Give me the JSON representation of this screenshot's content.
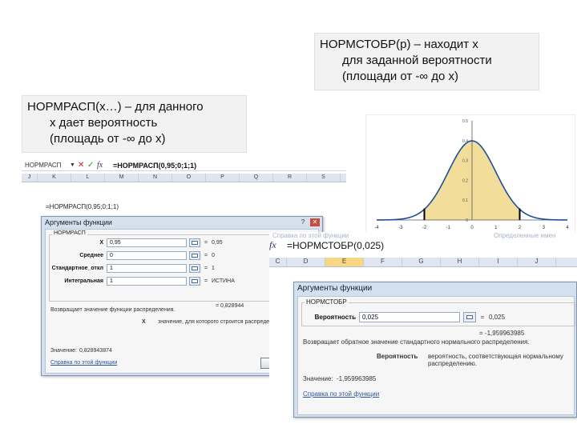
{
  "notes": {
    "right": {
      "line1": "НОРМСТОБР(р) – находит x",
      "line2": "для заданной вероятности",
      "line3": "(площади от -∞ до x)"
    },
    "left": {
      "line1": "НОРМРАСП(x…) – для данного",
      "line2": "x дает вероятность",
      "line3": "(площадь от -∞ до x)"
    }
  },
  "chart_data": {
    "type": "area",
    "description_free": true,
    "x_ticks": [
      "-4",
      "-3",
      "-2",
      "-1",
      "0",
      "1",
      "2",
      "3",
      "4"
    ],
    "y_ticks": [
      "0",
      "0.1",
      "0.2",
      "0.3",
      "0.4",
      "0.5"
    ],
    "xlim": [
      -4,
      4
    ],
    "ylim": [
      0,
      0.5
    ],
    "curve": "standard normal density",
    "shaded_range": [
      -2,
      2
    ],
    "markers_x": [
      -2,
      2
    ],
    "colors": {
      "fill": "#f3dd9b",
      "line": "#1f4e9a",
      "marker": "#000000"
    }
  },
  "excel_left": {
    "namebox": "НОРМРАСП",
    "formula": "=НОРМРАСП(0,95;0;1;1)",
    "fx_symbol": "fx",
    "columns": [
      "J",
      "K",
      "L",
      "M",
      "N",
      "O",
      "P",
      "Q",
      "R",
      "S"
    ],
    "cell_text": "=НОРМРАСП(0,95;0;1;1)",
    "dialog": {
      "title": "Аргументы функции",
      "group_label": "НОРМРАСП",
      "args": [
        {
          "label": "X",
          "value": "0,95",
          "result": "0,95"
        },
        {
          "label": "Среднее",
          "value": "0",
          "result": "0"
        },
        {
          "label": "Стандартное_откл",
          "value": "1",
          "result": "1"
        },
        {
          "label": "Интегральная",
          "value": "1",
          "result": "ИСТИНА"
        }
      ],
      "eq_sign": "=",
      "extra_result": "0,828944",
      "description": "Возвращает значение функции распределения.",
      "arg_help_name": "X",
      "arg_help": "значение, для которого строится распределение.",
      "value_label": "Значение:",
      "value": "0,828943874",
      "help_link": "Справка по этой функции",
      "ok_label": "ОК"
    }
  },
  "excel_right": {
    "faded_left": "Справка по этой функции",
    "faded_right": "Определенные имен",
    "formula": "=НОРМСТОБР(0,025)",
    "fx_symbol": "fx",
    "columns": [
      "C",
      "D",
      "E",
      "F",
      "G",
      "H",
      "I",
      "J"
    ],
    "selected_column": "E",
    "dialog": {
      "title": "Аргументы функции",
      "group_label": "НОРМСТОБР",
      "arg_label": "Вероятность",
      "arg_value": "0,025",
      "eq_sign": "=",
      "arg_result": "0,025",
      "total_result": "-1,959963985",
      "description": "Возвращает обратное значение стандартного нормального распределения.",
      "arg_help_name": "Вероятность",
      "arg_help": "вероятность, соответствующая нормальному распределению.",
      "value_label": "Значение:",
      "value": "-1,959963985",
      "help_link": "Справка по этой функции",
      "ok_label": "ОК"
    }
  }
}
